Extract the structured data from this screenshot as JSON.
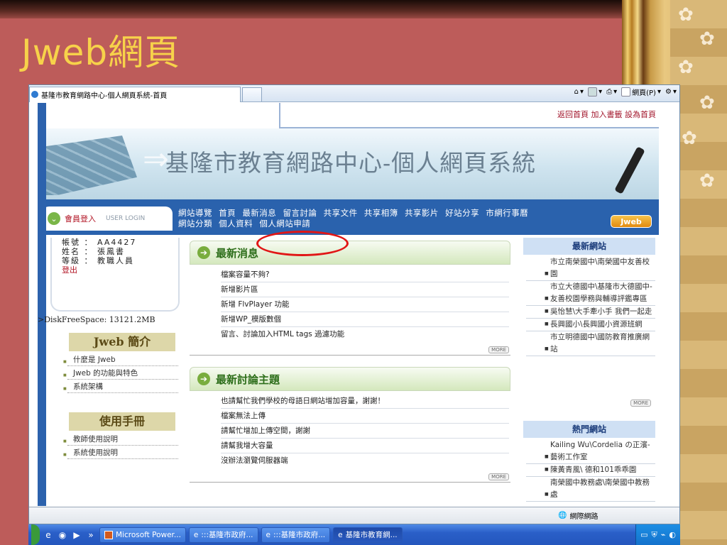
{
  "slide": {
    "title": "Jweb網頁"
  },
  "browser": {
    "tab_title": "基隆市教育網路中心-個人網頁系統-首頁",
    "cmd_page": "網頁(P)",
    "status_zone": "網際網路"
  },
  "site": {
    "top_links": [
      "返回首頁",
      "加入書籤",
      "設為首頁"
    ],
    "banner_title": "基隆市教育網路中心-個人網頁系統",
    "login_zh": "會員登入",
    "login_en": "USER LOGIN",
    "nav_row1": [
      "網站導覽",
      "首頁",
      "最新消息",
      "留言討論",
      "共享文件",
      "共享相簿",
      "共享影片",
      "好站分享",
      "市網行事曆"
    ],
    "nav_row2": [
      "網站分類",
      "個人資料",
      "個人網站申請"
    ],
    "badge": "Jweb",
    "user": {
      "account": "帳號 ： AA4427",
      "name": "姓名 ： 張鳳書",
      "level": "等級 ： 教職人員",
      "logout": "登出"
    },
    "disk_space": ">DiskFreeSpace: 13121.2MB",
    "intro_head": "Jweb 簡介",
    "intro_items": [
      "什麼是 Jweb",
      "Jweb 的功能與特色",
      "系統架構"
    ],
    "manual_head": "使用手冊",
    "manual_items": [
      "教師使用說明",
      "系統使用說明"
    ],
    "news_title": "最新消息",
    "news_items": [
      "檔案容量不夠?",
      "新增影片區",
      "新增 FlvPlayer 功能",
      "新增WP_模版數個",
      "留言、討論加入HTML tags 過濾功能"
    ],
    "forum_title": "最新討論主題",
    "forum_items": [
      "也請幫忙我們學校的母語日網站增加容量，謝謝！",
      "檔案無法上傳",
      "請幫忙增加上傳空間，謝謝",
      "請幫我增大容量",
      "沒辦法瀏覽伺服器端"
    ],
    "more_label": "MORE",
    "latest_sites_head": "最新網站",
    "latest_sites": [
      "市立南榮國中\\南榮國中友善校園",
      "市立大德國中\\基隆市大德國中-友善校園學務與輔導評鑑專區",
      "吳怡慧\\大手牽小手 我們一起走",
      "長興國小\\長興國小資源班網",
      "市立明德國中\\國防教育推廣網站"
    ],
    "hot_sites_head": "熱門網站",
    "hot_sites": [
      "Kailing Wu\\Cordelia の正濱-藝術工作室",
      "陳黃青風\\ 德和101乖乖園",
      "南榮國中教務處\\南榮國中教務處"
    ]
  },
  "taskbar": {
    "buttons": [
      "Microsoft Power...",
      ":::基隆市政府...",
      ":::基隆市政府...",
      "基隆市教育網..."
    ]
  },
  "colors": {
    "slide_bg": "#bd5c5a",
    "title": "#f7d24a",
    "site_blue": "#2a62ad",
    "accent_red": "#e11616"
  }
}
